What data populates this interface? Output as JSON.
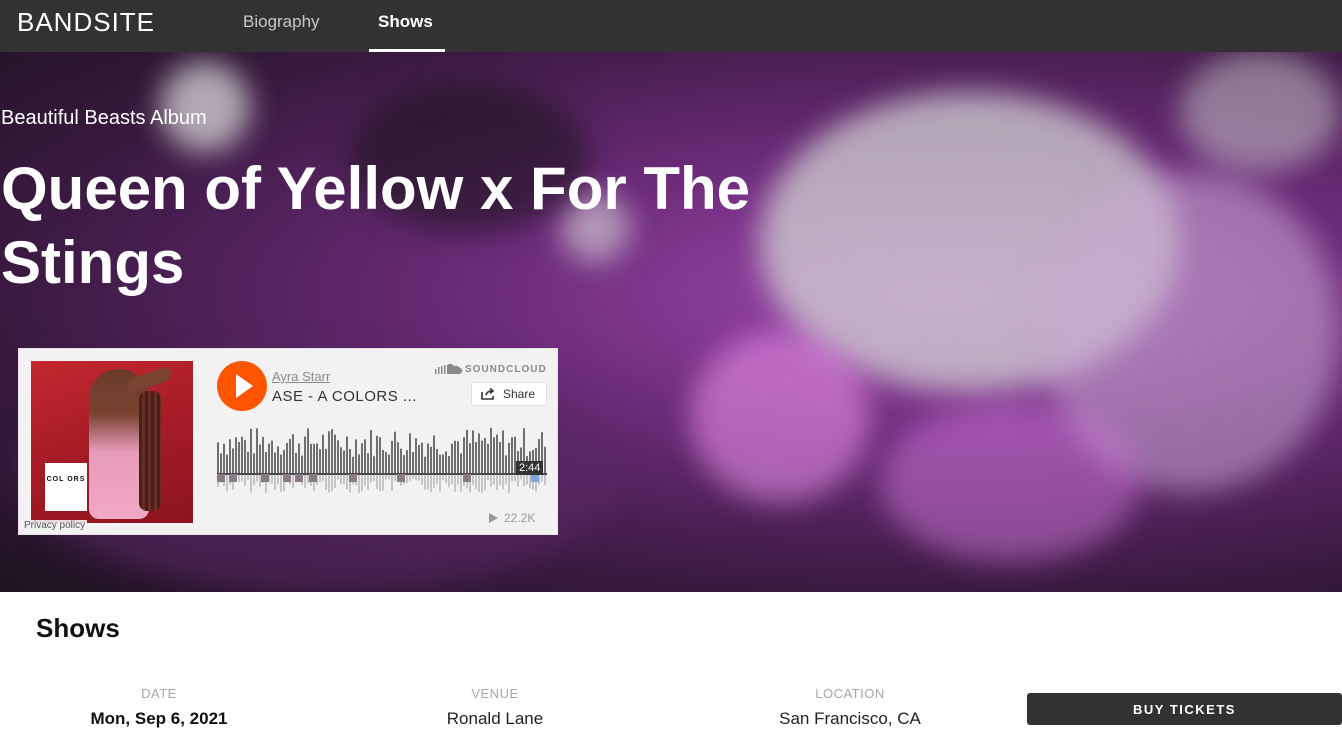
{
  "nav": {
    "logo": "BANDSITE",
    "links": [
      {
        "label": "Biography"
      },
      {
        "label": "Shows",
        "active": true
      }
    ]
  },
  "hero": {
    "subtitle": "Beautiful Beasts Album",
    "title": "Queen of Yellow x For The Stings"
  },
  "player": {
    "artist": "Ayra Starr",
    "track": "ASE - A COLORS ...",
    "brand": "SOUNDCLOUD",
    "share_label": "Share",
    "duration": "2:44",
    "plays": "22.2K",
    "privacy": "Privacy policy",
    "art_text": "COL ORS",
    "accent_color": "#ff5500"
  },
  "shows": {
    "heading": "Shows",
    "columns": {
      "date": "DATE",
      "venue": "VENUE",
      "location": "LOCATION"
    },
    "rows": [
      {
        "date": "Mon, Sep 6, 2021",
        "venue": "Ronald Lane",
        "location": "San Francisco, CA",
        "button": "BUY TICKETS"
      }
    ]
  }
}
